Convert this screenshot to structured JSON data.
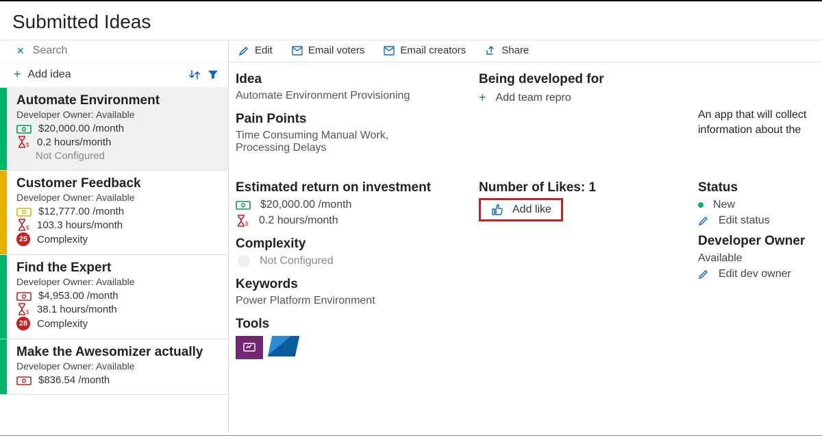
{
  "pageTitle": "Submitted Ideas",
  "search": {
    "placeholder": "Search"
  },
  "addIdea": {
    "label": "Add idea"
  },
  "ideas": [
    {
      "title": "Automate Environment",
      "owner": "Developer Owner: Available",
      "cost": "$20,000.00 /month",
      "hours": "0.2 hours/month",
      "complexity": "Not Configured",
      "stripe": "green",
      "badge": null,
      "cost_color": "green",
      "selected": true
    },
    {
      "title": "Customer Feedback",
      "owner": "Developer Owner: Available",
      "cost": "$12,777.00 /month",
      "hours": "103.3 hours/month",
      "complexity": "Complexity",
      "stripe": "yellow",
      "badge": "25",
      "cost_color": "yellow",
      "selected": false
    },
    {
      "title": "Find the Expert",
      "owner": "Developer Owner: Available",
      "cost": "$4,953.00 /month",
      "hours": "38.1 hours/month",
      "complexity": "Complexity",
      "stripe": "green",
      "badge": "28",
      "cost_color": "red",
      "selected": false
    },
    {
      "title": "Make the Awesomizer actually",
      "owner": "Developer Owner: Available",
      "cost": "$836.54 /month",
      "hours": "",
      "complexity": "",
      "stripe": "green",
      "badge": null,
      "cost_color": "red",
      "selected": false
    }
  ],
  "toolbar": {
    "edit": "Edit",
    "emailVoters": "Email voters",
    "emailCreators": "Email creators",
    "share": "Share"
  },
  "detail": {
    "idea": {
      "label": "Idea",
      "value": "Automate Environment Provisioning"
    },
    "painPoints": {
      "label": "Pain Points",
      "value": "Time Consuming Manual Work, Processing Delays"
    },
    "roi": {
      "label": "Estimated return on investment",
      "cost": "$20,000.00 /month",
      "hours": "0.2 hours/month"
    },
    "complexity": {
      "label": "Complexity",
      "value": "Not Configured"
    },
    "keywords": {
      "label": "Keywords",
      "value": "Power Platform Environment"
    },
    "tools": {
      "label": "Tools"
    },
    "beingDev": {
      "label": "Being developed for",
      "addTeam": "Add team repro"
    },
    "likes": {
      "label": "Number of Likes: 1",
      "addLike": "Add like"
    },
    "status": {
      "label": "Status",
      "value": "New",
      "edit": "Edit status"
    },
    "devOwner": {
      "label": "Developer Owner",
      "value": "Available",
      "edit": "Edit dev owner"
    },
    "description": "An app that will collect information about the"
  }
}
